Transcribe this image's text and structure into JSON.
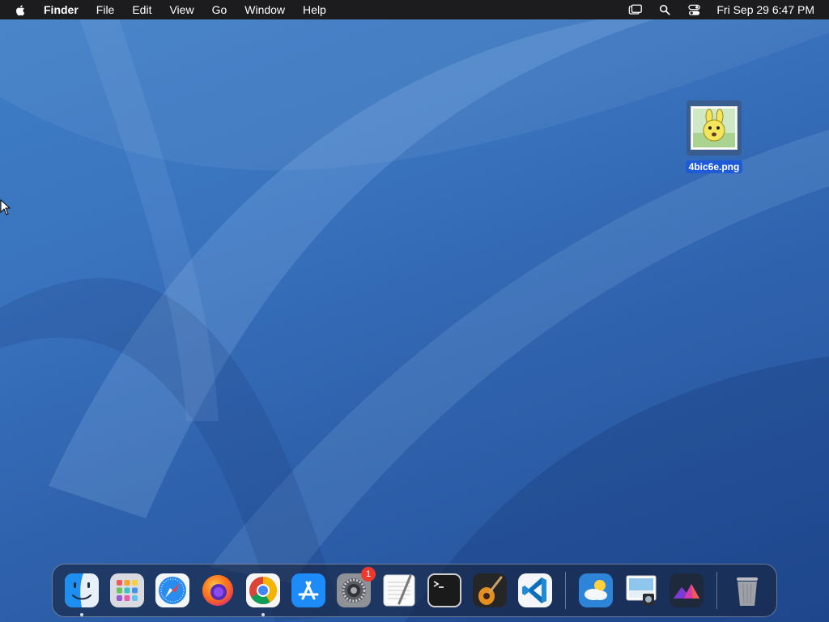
{
  "menubar": {
    "apple_icon": "apple-logo-icon",
    "app_name": "Finder",
    "items": [
      "File",
      "Edit",
      "View",
      "Go",
      "Window",
      "Help"
    ],
    "status_icons": [
      "screen-mirroring-icon",
      "spotlight-search-icon",
      "control-center-icon"
    ],
    "clock": "Fri Sep 29  6:47 PM"
  },
  "desktop": {
    "file": {
      "name": "4bic6e.png",
      "icon": "image-file-icon",
      "selected": true
    }
  },
  "dock": {
    "apps": [
      {
        "name": "Finder",
        "icon": "finder-icon",
        "running": true
      },
      {
        "name": "Launchpad",
        "icon": "launchpad-icon",
        "running": false
      },
      {
        "name": "Safari",
        "icon": "safari-icon",
        "running": false
      },
      {
        "name": "Firefox",
        "icon": "firefox-icon",
        "running": false
      },
      {
        "name": "Google Chrome",
        "icon": "chrome-icon",
        "running": true
      },
      {
        "name": "App Store",
        "icon": "app-store-icon",
        "running": false
      },
      {
        "name": "System Settings",
        "icon": "system-settings-icon",
        "running": false,
        "badge": "1"
      },
      {
        "name": "TextEdit",
        "icon": "textedit-icon",
        "running": false
      },
      {
        "name": "Terminal",
        "icon": "terminal-icon",
        "running": false
      },
      {
        "name": "GarageBand",
        "icon": "garageband-icon",
        "running": false
      },
      {
        "name": "Visual Studio Code",
        "icon": "vscode-icon",
        "running": false
      }
    ],
    "recent": [
      {
        "name": "Weather",
        "icon": "weather-icon"
      },
      {
        "name": "Preview",
        "icon": "preview-icon"
      },
      {
        "name": "Affinity Photo",
        "icon": "mountain-app-icon"
      }
    ],
    "trash": {
      "name": "Trash",
      "icon": "trash-icon"
    }
  },
  "colors": {
    "menubar_bg": "#1c1c1e",
    "wallpaper_top": "#3f7fc7",
    "wallpaper_bottom": "#234f98",
    "selection_blue": "#1e5bd6",
    "badge_red": "#ea3a2f"
  }
}
